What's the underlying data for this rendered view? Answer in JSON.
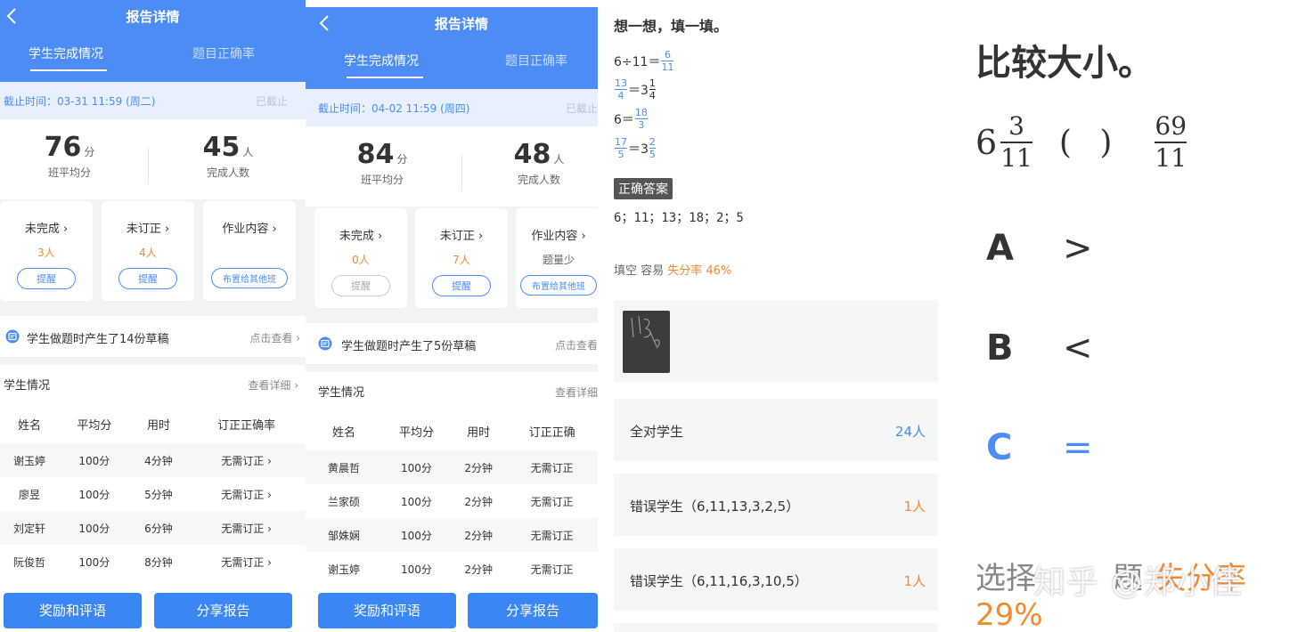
{
  "colors": {
    "primary": "#4b8cf5",
    "accent": "#f28a30"
  },
  "p1": {
    "title": "报告详情",
    "tabs": [
      "学生完成情况",
      "题目正确率"
    ],
    "deadline": "截止时间：03-31 11:59 (周二)",
    "ended": "已截止",
    "avg": "76",
    "avg_unit": "分",
    "avg_label": "班平均分",
    "done": "45",
    "done_unit": "人",
    "done_label": "完成人数",
    "cards": [
      {
        "title": "未完成 ›",
        "value": "3人",
        "btn": "提醒"
      },
      {
        "title": "未订正 ›",
        "value": "4人",
        "btn": "提醒"
      },
      {
        "title": "作业内容 ›",
        "value": "",
        "btn": "布置给其他班"
      }
    ],
    "draft": "学生做题时产生了14份草稿",
    "draft_link": "点击查看 ›",
    "students_title": "学生情况",
    "students_link": "查看详细 ›",
    "headers": [
      "姓名",
      "平均分",
      "用时",
      "订正正确率"
    ],
    "rows": [
      [
        "谢玉婷",
        "100分",
        "4分钟",
        "无需订正 ›"
      ],
      [
        "廖昱",
        "100分",
        "5分钟",
        "无需订正 ›"
      ],
      [
        "刘定轩",
        "100分",
        "6分钟",
        "无需订正 ›"
      ],
      [
        "阮俊哲",
        "100分",
        "8分钟",
        "无需订正 ›"
      ]
    ],
    "btn_reward": "奖励和评语",
    "btn_share": "分享报告"
  },
  "p2": {
    "title": "报告详情",
    "tabs": [
      "学生完成情况",
      "题目正确率"
    ],
    "deadline": "截止时间：04-02 11:59 (周四)",
    "ended": "已截止",
    "avg": "84",
    "avg_unit": "分",
    "avg_label": "班平均分",
    "done": "48",
    "done_unit": "人",
    "done_label": "完成人数",
    "cards": [
      {
        "title": "未完成 ›",
        "value": "0人",
        "btn": "提醒"
      },
      {
        "title": "未订正 ›",
        "value": "7人",
        "btn": "提醒"
      },
      {
        "title": "作业内容 ›",
        "value": "题量少",
        "btn": "布置给其他班"
      }
    ],
    "draft": "学生做题时产生了5份草稿",
    "draft_link": "点击查看",
    "students_title": "学生情况",
    "students_link": "查看详细",
    "headers": [
      "姓名",
      "平均分",
      "用时",
      "订正正确"
    ],
    "rows": [
      [
        "黄晨哲",
        "100分",
        "2分钟",
        "无需订正"
      ],
      [
        "兰家硕",
        "100分",
        "2分钟",
        "无需订正"
      ],
      [
        "邹姝娴",
        "100分",
        "2分钟",
        "无需订正"
      ],
      [
        "谢玉婷",
        "100分",
        "2分钟",
        "无需订正"
      ]
    ],
    "btn_reward": "奖励和评语",
    "btn_share": "分享报告"
  },
  "p3": {
    "question": "想一想，填一填。",
    "l1": {
      "pre": "6÷11＝",
      "fn": "6",
      "fd": "11"
    },
    "l2": {
      "fn": "13",
      "fd": "4",
      "mid": "＝3",
      "gn": "1",
      "gd": "4"
    },
    "l3": {
      "pre": "6＝",
      "fn": "18",
      "fd": "3"
    },
    "l4": {
      "fn": "17",
      "fd": "5",
      "mid": "＝3",
      "gn": "2",
      "gd": "5"
    },
    "answer_tag": "正确答案",
    "answer": "6；11；13；18；2；5",
    "meta_type": "填空 容易 ",
    "meta_rate": "失分率 46%",
    "results": [
      {
        "label": "全对学生",
        "count": "24人"
      },
      {
        "label": "错误学生（6,11,13,3,2,5）",
        "count": "1人"
      },
      {
        "label": "错误学生（6,11,16,3,10,5）",
        "count": "1人"
      }
    ]
  },
  "p4": {
    "question": "比较大小。",
    "int": "6",
    "fn": "3",
    "fd": "11",
    "paren": "( )",
    "gn": "69",
    "gd": "11",
    "options": [
      {
        "letter": "A",
        "symbol": ">"
      },
      {
        "letter": "B",
        "symbol": "<"
      },
      {
        "letter": "C",
        "symbol": "="
      }
    ],
    "bottom_a": "选择",
    "bottom_b": "题",
    "bottom_rate": "失分率 29%",
    "watermark": "知乎 @郑小佳"
  }
}
